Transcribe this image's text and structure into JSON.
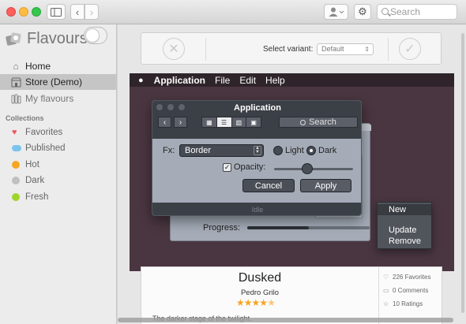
{
  "toolbar": {
    "search_placeholder": "Search",
    "icons": [
      "sidebar-toggle-icon",
      "chevron-left-icon",
      "chevron-right-icon",
      "user-icon",
      "gear-icon",
      "search-icon"
    ]
  },
  "sidebar": {
    "app_title": "Flavours",
    "nav": [
      {
        "label": "Home",
        "icon": "home-icon"
      },
      {
        "label": "Store (Demo)",
        "icon": "store-icon",
        "selected": true
      },
      {
        "label": "My flavours",
        "icon": "flavours-icon"
      }
    ],
    "collections_heading": "Collections",
    "collections": [
      {
        "label": "Favorites",
        "color": "#f0565a",
        "icon": "heart-icon"
      },
      {
        "label": "Published",
        "color": "#7cc4ee",
        "icon": "cloud-icon"
      },
      {
        "label": "Hot",
        "color": "#f5a623"
      },
      {
        "label": "Dark",
        "color": "#c0c0c0"
      },
      {
        "label": "Fresh",
        "color": "#9fd42c"
      }
    ]
  },
  "variant_bar": {
    "label": "Select variant:",
    "selected": "Default"
  },
  "preview": {
    "menubar": {
      "app": "Application",
      "items": [
        "File",
        "Edit",
        "Help"
      ]
    },
    "window": {
      "title": "Application",
      "search_label": "Search",
      "fx_label": "Fx:",
      "fx_value": "Border",
      "radio_light": "Light",
      "radio_dark": "Dark",
      "selected_mode": "Dark",
      "opacity_label": "Opacity:",
      "opacity_value": 0.42,
      "cancel_label": "Cancel",
      "apply_label": "Apply",
      "status": "Idle"
    },
    "background_window": {
      "progress_label": "Progress:",
      "progress_value": 0.5
    },
    "context_menu": {
      "items": [
        "New",
        "Update",
        "Remove"
      ]
    }
  },
  "flavour_card": {
    "title": "Dusked",
    "author": "Pedro Grilo",
    "rating": 4.5,
    "description": "The darker stage of the twilight.",
    "favorites": "226 Favorites",
    "comments": "0 Comments",
    "ratings": "10 Ratings"
  }
}
